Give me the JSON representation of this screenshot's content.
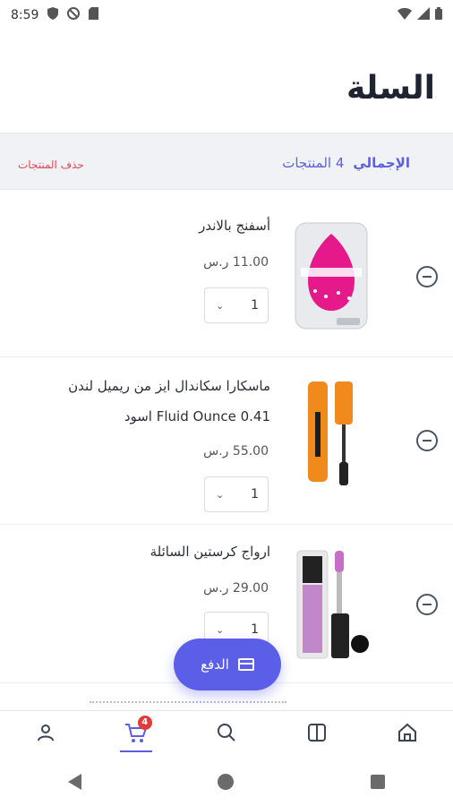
{
  "status_bar": {
    "time": "8:59"
  },
  "header": {
    "title": "السلة"
  },
  "summary": {
    "total_label": "الإجمالي",
    "count_text": "4 المنتجات",
    "delete_label": "حذف المنتجات"
  },
  "items": [
    {
      "name": "أسفنج بالاندر",
      "price": "11.00 ر.س",
      "quantity": "1"
    },
    {
      "name_line1": "ماسكارا سكاندال ايز من ريميل لندن",
      "name_line2": "0.41 Fluid Ounce اسود",
      "price": "55.00 ر.س",
      "quantity": "1"
    },
    {
      "name": "ارواج كرستين السائلة",
      "price": "29.00 ر.س",
      "quantity": "1"
    }
  ],
  "checkout": {
    "label": "الدفع"
  },
  "nav": {
    "cart_badge": "4"
  },
  "colors": {
    "accent": "#5b5fe0",
    "delete": "#e0495a",
    "badge": "#e23b3b"
  }
}
